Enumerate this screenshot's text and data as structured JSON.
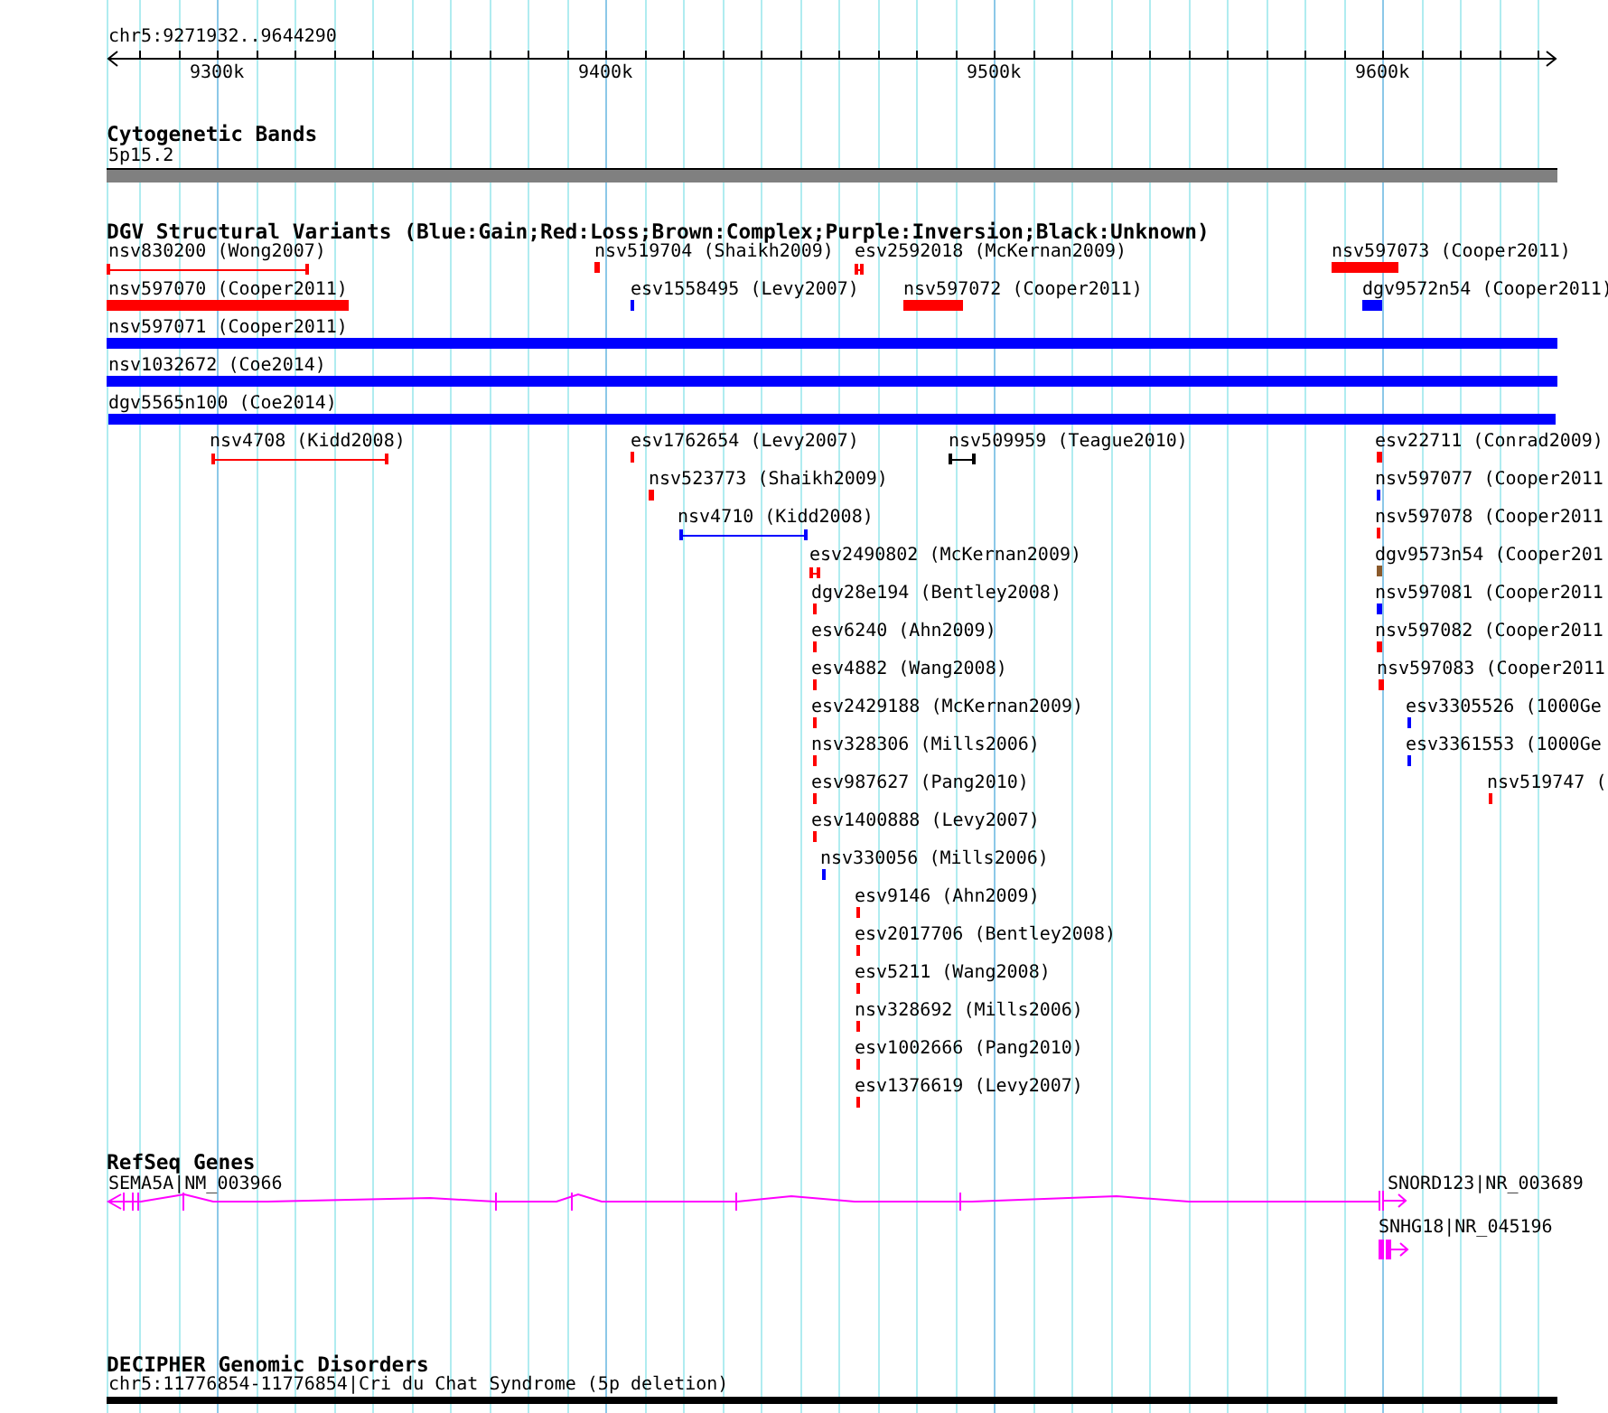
{
  "ruler": {
    "label": "chr5:9271932..9644290",
    "ticks": [
      "9300k",
      "9400k",
      "9500k",
      "9600k"
    ]
  },
  "tracks": [
    {
      "kind": "bands",
      "title": "Cytogenetic Bands",
      "features": [
        {
          "label": "5p15.2"
        }
      ]
    },
    {
      "kind": "variants",
      "title": "DGV Structural Variants (Blue:Gain;Red:Loss;Brown:Complex;Purple:Inversion;Black:Unknown)",
      "features": [
        {
          "label": "nsv830200 (Wong2007)",
          "color": "#ff0000",
          "kind": "span"
        },
        {
          "label": "nsv519704 (Shaikh2009)",
          "color": "#ff0000",
          "kind": "bar"
        },
        {
          "label": "esv2592018 (McKernan2009)",
          "color": "#ff0000",
          "kind": "span"
        },
        {
          "label": "nsv597073 (Cooper2011)",
          "color": "#ff0000",
          "kind": "bar"
        },
        {
          "label": "nsv597070 (Cooper2011)",
          "color": "#ff0000",
          "kind": "bar"
        },
        {
          "label": "esv1558495 (Levy2007)",
          "color": "#0000ff",
          "kind": "bar"
        },
        {
          "label": "nsv597072 (Cooper2011)",
          "color": "#ff0000",
          "kind": "bar"
        },
        {
          "label": "dgv9572n54 (Cooper2011)",
          "color": "#0000ff",
          "kind": "bar"
        },
        {
          "label": "nsv597071 (Cooper2011)",
          "color": "#0000ff",
          "kind": "bar"
        },
        {
          "label": "nsv1032672 (Coe2014)",
          "color": "#0000ff",
          "kind": "bar"
        },
        {
          "label": "dgv5565n100 (Coe2014)",
          "color": "#0000ff",
          "kind": "bar"
        },
        {
          "label": "nsv4708 (Kidd2008)",
          "color": "#ff0000",
          "kind": "span"
        },
        {
          "label": "esv1762654 (Levy2007)",
          "color": "#ff0000",
          "kind": "bar"
        },
        {
          "label": "nsv509959 (Teague2010)",
          "color": "#000000",
          "kind": "span"
        },
        {
          "label": "esv22711 (Conrad2009)",
          "color": "#ff0000",
          "kind": "bar"
        },
        {
          "label": "nsv523773 (Shaikh2009)",
          "color": "#ff0000",
          "kind": "bar"
        },
        {
          "label": "nsv597077 (Cooper2011",
          "color": "#0000ff",
          "kind": "bar"
        },
        {
          "label": "nsv4710 (Kidd2008)",
          "color": "#0000ff",
          "kind": "span"
        },
        {
          "label": "nsv597078 (Cooper2011",
          "color": "#ff0000",
          "kind": "bar"
        },
        {
          "label": "esv2490802 (McKernan2009)",
          "color": "#ff0000",
          "kind": "span"
        },
        {
          "label": "dgv9573n54 (Cooper201",
          "color": "#8b5a2b",
          "kind": "bar"
        },
        {
          "label": "dgv28e194 (Bentley2008)",
          "color": "#ff0000",
          "kind": "bar"
        },
        {
          "label": "nsv597081 (Cooper2011",
          "color": "#0000ff",
          "kind": "bar"
        },
        {
          "label": "esv6240 (Ahn2009)",
          "color": "#ff0000",
          "kind": "bar"
        },
        {
          "label": "nsv597082 (Cooper2011",
          "color": "#ff0000",
          "kind": "bar"
        },
        {
          "label": "esv4882 (Wang2008)",
          "color": "#ff0000",
          "kind": "bar"
        },
        {
          "label": "nsv597083 (Cooper2011",
          "color": "#ff0000",
          "kind": "bar"
        },
        {
          "label": "esv2429188 (McKernan2009)",
          "color": "#ff0000",
          "kind": "bar"
        },
        {
          "label": "esv3305526 (1000Ge",
          "color": "#0000ff",
          "kind": "bar"
        },
        {
          "label": "nsv328306 (Mills2006)",
          "color": "#ff0000",
          "kind": "bar"
        },
        {
          "label": "esv3361553 (1000Ge",
          "color": "#0000ff",
          "kind": "bar"
        },
        {
          "label": "esv987627 (Pang2010)",
          "color": "#ff0000",
          "kind": "bar"
        },
        {
          "label": "nsv519747 (",
          "color": "#ff0000",
          "kind": "bar"
        },
        {
          "label": "esv1400888 (Levy2007)",
          "color": "#ff0000",
          "kind": "bar"
        },
        {
          "label": "nsv330056 (Mills2006)",
          "color": "#0000ff",
          "kind": "bar"
        },
        {
          "label": "esv9146 (Ahn2009)",
          "color": "#ff0000",
          "kind": "bar"
        },
        {
          "label": "esv2017706 (Bentley2008)",
          "color": "#ff0000",
          "kind": "bar"
        },
        {
          "label": "esv5211 (Wang2008)",
          "color": "#ff0000",
          "kind": "bar"
        },
        {
          "label": "nsv328692 (Mills2006)",
          "color": "#ff0000",
          "kind": "bar"
        },
        {
          "label": "esv1002666 (Pang2010)",
          "color": "#ff0000",
          "kind": "bar"
        },
        {
          "label": "esv1376619 (Levy2007)",
          "color": "#ff0000",
          "kind": "bar"
        }
      ]
    },
    {
      "kind": "genes",
      "title": "RefSeq Genes",
      "features": [
        {
          "label": "SEMA5A|NM_003966"
        },
        {
          "label": "SNORD123|NR_003689"
        },
        {
          "label": "SNHG18|NR_045196"
        }
      ]
    },
    {
      "kind": "disorders",
      "title": "DECIPHER Genomic Disorders",
      "features": [
        {
          "label": "chr5:11776854-11776854|Cri du Chat Syndrome (5p deletion)"
        }
      ]
    }
  ]
}
